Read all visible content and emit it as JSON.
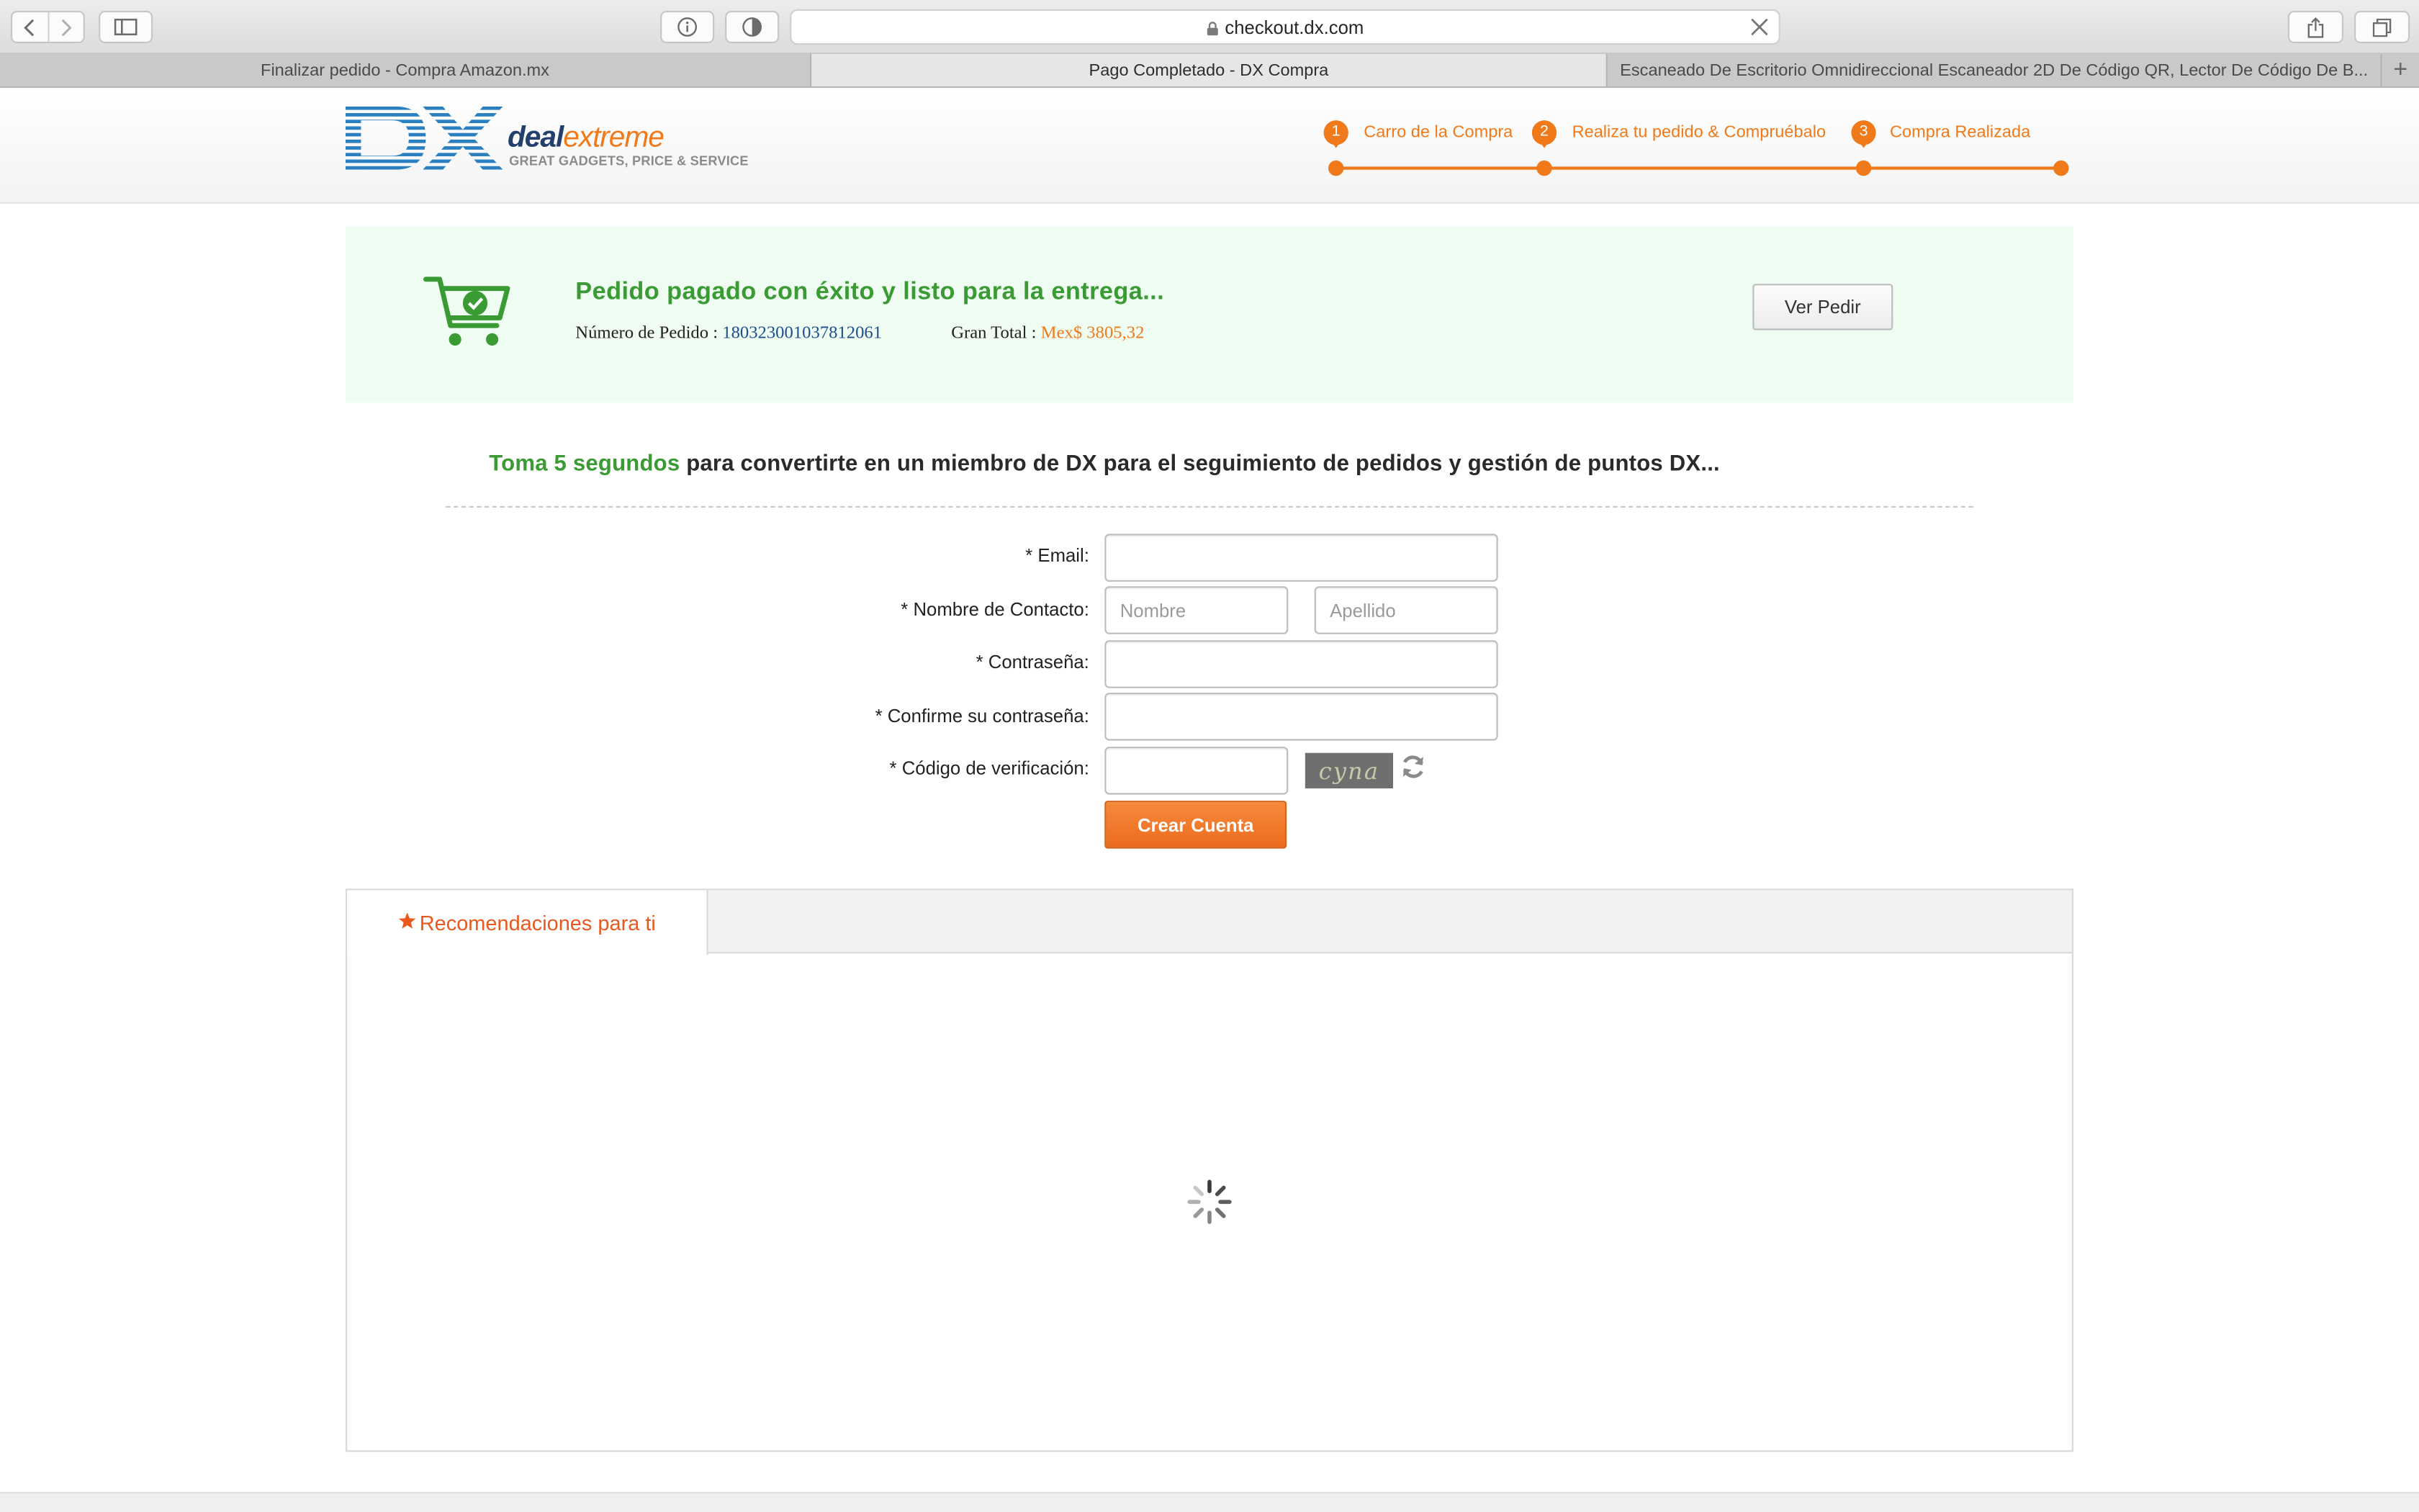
{
  "browser": {
    "url": "checkout.dx.com",
    "tabs": [
      {
        "label": "Finalizar pedido - Compra Amazon.mx",
        "active": false
      },
      {
        "label": "Pago Completado - DX Compra",
        "active": true
      },
      {
        "label": "Escaneado De Escritorio Omnidireccional Escaneador 2D De Código QR, Lector De Código De B...",
        "active": false
      }
    ],
    "new_tab": "+"
  },
  "site": {
    "brand_deal": "deal",
    "brand_extreme": "extreme",
    "brand_tagline": "GREAT GADGETS, PRICE & SERVICE",
    "steps": [
      {
        "num": "1",
        "label": "Carro de la Compra"
      },
      {
        "num": "2",
        "label": "Realiza tu pedido & Compruébalo"
      },
      {
        "num": "3",
        "label": "Compra Realizada"
      }
    ]
  },
  "success": {
    "title": "Pedido pagado con éxito y listo para la entrega...",
    "order_label": "Número de Pedido : ",
    "order_number": "180323001037812061",
    "total_label": "Gran Total : ",
    "total_value": "Mex$ 3805,32",
    "view_button": "Ver Pedir"
  },
  "register": {
    "headline_green": "Toma 5 segundos",
    "headline_rest": " para convertirte en un miembro de DX para el seguimiento de pedidos y gestión de puntos DX...",
    "email_label": "* Email:",
    "email_value": "",
    "contact_label": "* Nombre de Contacto:",
    "first_name_placeholder": "Nombre",
    "last_name_placeholder": "Apellido",
    "password_label": "* Contraseña:",
    "confirm_label": "* Confirme su contraseña:",
    "code_label": "* Código de verificación:",
    "captcha_text": "cyna",
    "create_button": "Crear Cuenta"
  },
  "recommendations": {
    "tab_label": "Recomendaciones para ti"
  },
  "colors": {
    "accent_orange": "#f07a1a",
    "success_green": "#3a9a33",
    "success_bg": "#eefcf1",
    "order_blue": "#1f4e8f"
  },
  "icons": [
    "back-icon",
    "forward-icon",
    "sidebar-icon",
    "info-icon",
    "shield-icon",
    "lock-icon",
    "close-icon",
    "share-icon",
    "tabs-overview-icon",
    "cart-check-icon",
    "refresh-icon",
    "star-icon",
    "loading-spinner-icon"
  ]
}
